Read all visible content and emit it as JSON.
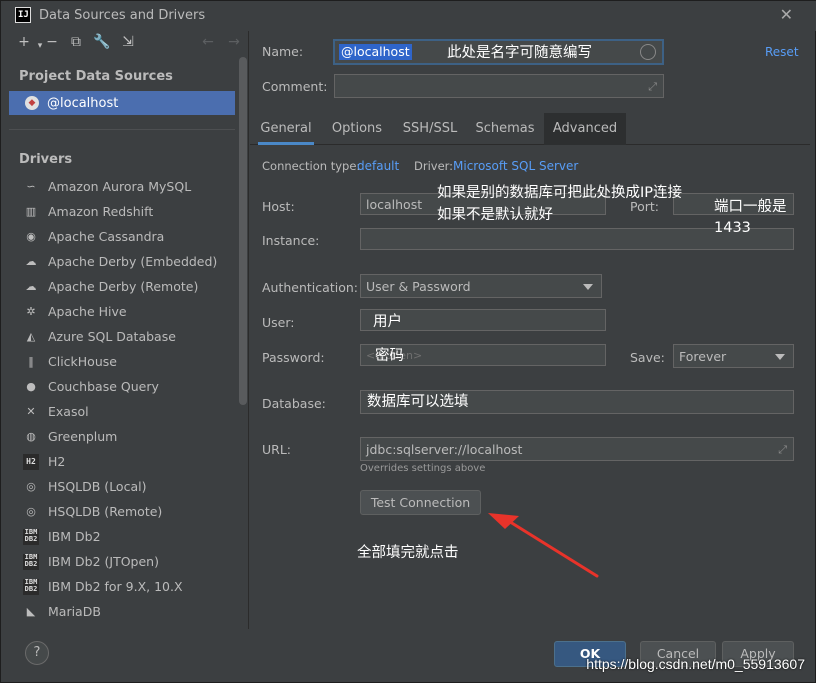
{
  "window": {
    "title": "Data Sources and Drivers",
    "app_icon": "IJ"
  },
  "left": {
    "project_section_title": "Project Data Sources",
    "project_items": [
      {
        "label": "@localhost",
        "icon": "sql-server-icon"
      }
    ],
    "drivers_section_title": "Drivers",
    "drivers": [
      {
        "label": "Amazon Aurora MySQL",
        "icon": "dolphin-icon"
      },
      {
        "label": "Amazon Redshift",
        "icon": "redshift-icon"
      },
      {
        "label": "Apache Cassandra",
        "icon": "eye-icon"
      },
      {
        "label": "Apache Derby (Embedded)",
        "icon": "derby-icon"
      },
      {
        "label": "Apache Derby (Remote)",
        "icon": "derby-icon"
      },
      {
        "label": "Apache Hive",
        "icon": "hive-icon"
      },
      {
        "label": "Azure SQL Database",
        "icon": "azure-icon"
      },
      {
        "label": "ClickHouse",
        "icon": "clickhouse-icon"
      },
      {
        "label": "Couchbase Query",
        "icon": "couchbase-icon"
      },
      {
        "label": "Exasol",
        "icon": "exasol-icon"
      },
      {
        "label": "Greenplum",
        "icon": "greenplum-icon"
      },
      {
        "label": "H2",
        "icon": "h2-icon"
      },
      {
        "label": "HSQLDB (Local)",
        "icon": "hsqldb-icon"
      },
      {
        "label": "HSQLDB (Remote)",
        "icon": "hsqldb-icon"
      },
      {
        "label": "IBM Db2",
        "icon": "ibm-db2-icon"
      },
      {
        "label": "IBM Db2 (JTOpen)",
        "icon": "ibm-db2-icon"
      },
      {
        "label": "IBM Db2 for 9.X, 10.X",
        "icon": "ibm-db2-icon"
      },
      {
        "label": "MariaDB",
        "icon": "mariadb-icon"
      }
    ]
  },
  "form": {
    "name_label": "Name:",
    "name_value": "@localhost",
    "reset_label": "Reset",
    "comment_label": "Comment:",
    "tabs": [
      "General",
      "Options",
      "SSH/SSL",
      "Schemas",
      "Advanced"
    ],
    "connection_type_label": "Connection type:",
    "connection_type_value": "default",
    "driver_label": "Driver:",
    "driver_value": "Microsoft SQL Server",
    "host_label": "Host:",
    "host_value": "localhost",
    "port_label": "Port:",
    "instance_label": "Instance:",
    "auth_label": "Authentication:",
    "auth_value": "User & Password",
    "user_label": "User:",
    "password_label": "Password:",
    "password_placeholder": "<hidden>",
    "save_label": "Save:",
    "save_value": "Forever",
    "database_label": "Database:",
    "url_label": "URL:",
    "url_value": "jdbc:sqlserver://localhost",
    "url_hint": "Overrides settings above",
    "test_connection_label": "Test Connection"
  },
  "footer": {
    "help_label": "?",
    "ok_label": "OK",
    "cancel_label": "Cancel",
    "apply_label": "Apply"
  },
  "annotations": {
    "name_note": "此处是名字可随意编写",
    "host_note_1": "如果是别的数据库可把此处换成IP连接",
    "host_note_2": "如果不是默认就好",
    "port_note_1": "端口一般是",
    "port_note_2": "1433",
    "user_note": "用户",
    "password_note": "密码",
    "database_note": "数据库可以选填",
    "click_note": "全部填完就点击",
    "arrow_color": "#e8332a"
  },
  "watermark": "https://blog.csdn.net/m0_55913607"
}
